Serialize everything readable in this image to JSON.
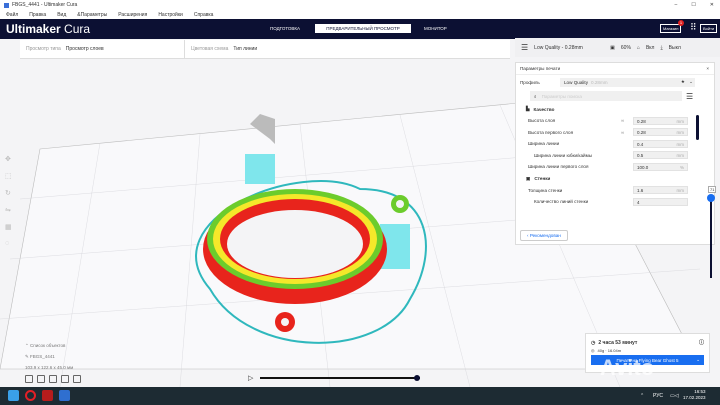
{
  "window": {
    "title": "FBGS_4441 - Ultimaker Cura",
    "controls": [
      "–",
      "☐",
      "✕"
    ]
  },
  "menu": [
    "Файл",
    "Правка",
    "Вид",
    "&Параметры",
    "Расширения",
    "Настройки",
    "Справка"
  ],
  "header": {
    "logo_bold": "Ultimaker",
    "logo_light": "Cura",
    "stages": [
      "ПОДГОТОВКА",
      "ПРЕДВАРИТЕЛЬНЫЙ ПРОСМОТР",
      "МОНИТОР"
    ],
    "active_stage": 1,
    "marketplace": "Магазин",
    "marketplace_badge": "1",
    "signin": "Войти"
  },
  "viewbar": {
    "view_type_label": "Просмотр типа",
    "view_type_value": "Просмотр слоев",
    "color_scheme_label": "Цветовая схема",
    "color_scheme_value": "Тип линии"
  },
  "quickbar": {
    "profile": "Low Quality - 0.28mm",
    "infill": "60%",
    "support": "Вкл",
    "adhesion": "Выкл"
  },
  "panel": {
    "title": "Параметры печати",
    "profile_label": "Профиль",
    "profile_value": "Low Quality",
    "profile_sub": "0.28mm",
    "search_placeholder": "Параметры поиска",
    "sections": [
      {
        "name": "Качество",
        "rows": [
          {
            "label": "Высота слоя",
            "value": "0.28",
            "unit": "mm",
            "linked": true
          },
          {
            "label": "Высота первого слоя",
            "value": "0.28",
            "unit": "mm",
            "linked": true
          },
          {
            "label": "Ширина линии",
            "value": "0.4",
            "unit": "mm"
          },
          {
            "label": "Ширина линии юбки/каймы",
            "value": "0.5",
            "unit": "mm",
            "indent": true
          },
          {
            "label": "Ширина линии первого слоя",
            "value": "100.0",
            "unit": "%"
          }
        ]
      },
      {
        "name": "Стенки",
        "rows": [
          {
            "label": "Толщина стенки",
            "value": "1.6",
            "unit": "mm"
          },
          {
            "label": "Количество линий стенки",
            "value": "4",
            "unit": "",
            "indent": true
          }
        ]
      }
    ],
    "recommended_button": "Рекомендован"
  },
  "layer_slider": {
    "current_layer": "71",
    "position_fraction": 0.45
  },
  "object": {
    "list_label": "Список объектов",
    "name": "FBGS_4441",
    "dimensions": "103.9 x 122.6 x 45.0 мм"
  },
  "print": {
    "time": "2 часа 53 минут",
    "material": "40g · 16.04m",
    "button": "Печать на Flying Bear Ghost 5"
  },
  "taskbar": {
    "lang": "РУС",
    "time": "16:53",
    "date": "17.02.2023"
  },
  "watermark": "Avito",
  "colors": {
    "header": "#0c1033",
    "accent": "#196ef0",
    "wall": "#e8241c",
    "infill": "#f5e82a",
    "skin": "#6ccc2c",
    "support": "#5ee0e6"
  }
}
